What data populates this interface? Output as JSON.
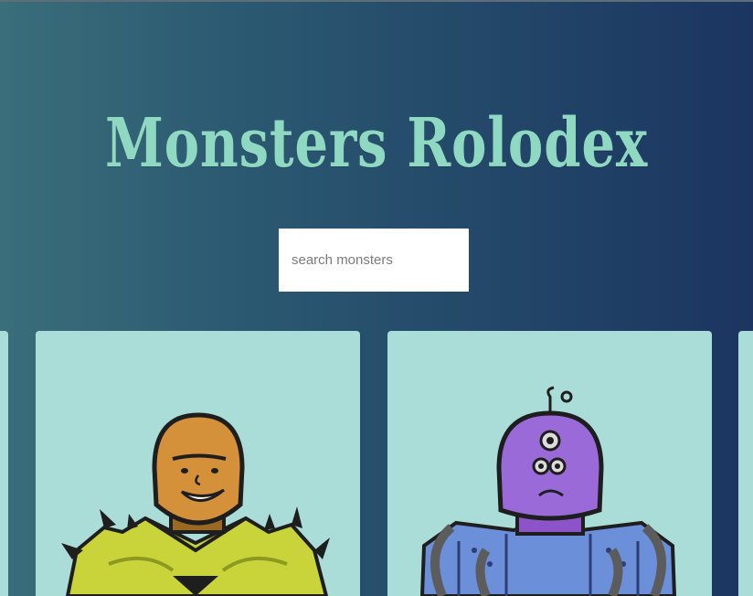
{
  "header": {
    "title": "Monsters Rolodex"
  },
  "search": {
    "placeholder": "search monsters",
    "value": ""
  },
  "cards": [
    {
      "avatar": "yellow-armored-monster-avatar",
      "head_color": "#d4913a",
      "body_color": "#c9d43a"
    },
    {
      "avatar": "purple-three-eyed-robot-monster-avatar",
      "head_color": "#9a6bd8",
      "body_color": "#6b8fd8"
    }
  ],
  "colors": {
    "title": "#8fd9c2",
    "card_background": "#aadcd8",
    "background_left": "#3a6e7a",
    "background_right": "#1b3560"
  }
}
